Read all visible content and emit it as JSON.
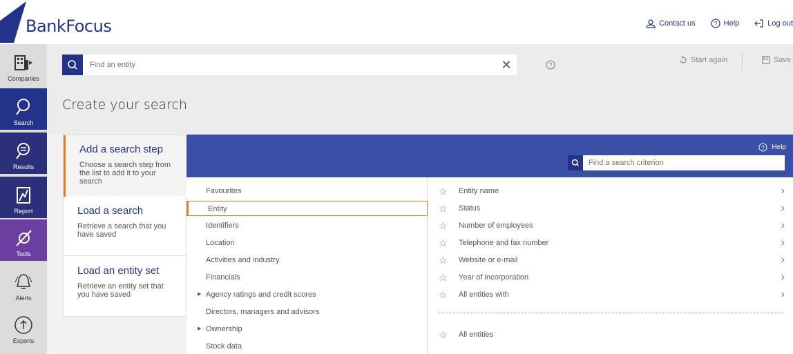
{
  "header": {
    "brand": "BankFocus",
    "links": [
      {
        "label": "Contact us",
        "icon": "user-icon"
      },
      {
        "label": "Help",
        "icon": "help-circle-icon"
      },
      {
        "label": "Log out",
        "icon": "logout-icon"
      }
    ]
  },
  "rail": {
    "items": [
      {
        "label": "Companies",
        "icon": "companies-icon"
      },
      {
        "label": "Search",
        "icon": "search-icon"
      },
      {
        "label": "Results",
        "icon": "results-icon"
      },
      {
        "label": "Report",
        "icon": "report-icon"
      },
      {
        "label": "Tools",
        "icon": "tools-icon"
      },
      {
        "label": "Alerts",
        "icon": "bell-icon"
      },
      {
        "label": "Exports",
        "icon": "export-icon"
      }
    ]
  },
  "search": {
    "placeholder": "Find an entity",
    "start_again": "Start again",
    "save": "Save"
  },
  "page_title": "Create your search",
  "steps": [
    {
      "title": "Add a search step",
      "desc": "Choose a search step from the list to add it to your search"
    },
    {
      "title": "Load a search",
      "desc": "Retrieve a search that you have saved"
    },
    {
      "title": "Load an entity set",
      "desc": "Retrieve an entity set that you have saved"
    }
  ],
  "strip": {
    "help": "Help",
    "criterion_placeholder": "Find a search criterion"
  },
  "categories": [
    {
      "label": "Favourites",
      "expandable": false
    },
    {
      "label": "Entity",
      "expandable": false
    },
    {
      "label": "Identifiers",
      "expandable": false
    },
    {
      "label": "Location",
      "expandable": false
    },
    {
      "label": "Activities and industry",
      "expandable": false
    },
    {
      "label": "Financials",
      "expandable": false
    },
    {
      "label": "Agency ratings and credit scores",
      "expandable": true
    },
    {
      "label": "Directors, managers and advisors",
      "expandable": false
    },
    {
      "label": "Ownership",
      "expandable": true
    },
    {
      "label": "Stock data",
      "expandable": false
    }
  ],
  "criteria": [
    "Entity name",
    "Status",
    "Number of employees",
    "Telephone and fax number",
    "Website or e-mail",
    "Year of incorporation",
    "All entities with"
  ],
  "all_entities": "All entities",
  "colors": {
    "brand": "#23338a",
    "strip": "#3a4fa6",
    "accent": "#e67e22"
  }
}
